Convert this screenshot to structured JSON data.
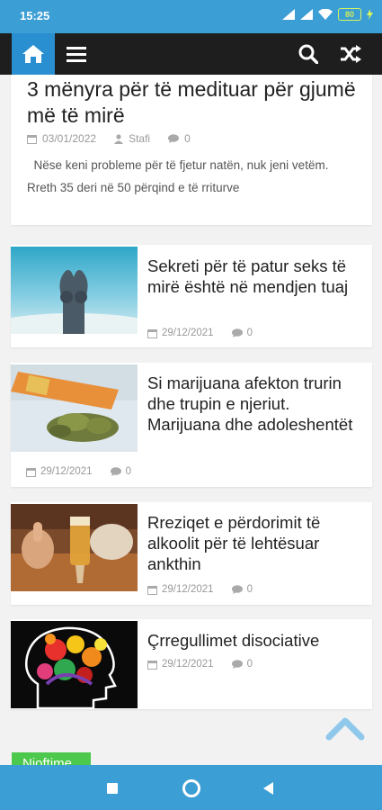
{
  "status_bar": {
    "time": "15:25",
    "battery": "80"
  },
  "header": {
    "icons": [
      "home-icon",
      "menu-icon",
      "search-icon",
      "shuffle-icon"
    ],
    "accent_color": "#2a8fd0",
    "background_color": "#1e1e1e"
  },
  "featured": {
    "title": "3 mënyra për të medituar për gjumë më të mirë",
    "date": "03/01/2022",
    "author": "Stafi",
    "comments": "0",
    "excerpt": "Nëse keni probleme për të fjetur natën, nuk jeni vetëm. Rreth 35 deri në 50 përqind e të rriturve"
  },
  "posts": [
    {
      "title": "Sekreti për të patur seks të mirë është në mendjen tuaj",
      "date": "29/12/2021",
      "comments": "0"
    },
    {
      "title": "Si marijuana afekton trurin dhe trupin e njeriut. Marijuana dhe adoleshentët",
      "date": "29/12/2021",
      "comments": "0"
    },
    {
      "title": "Rreziqet e përdorimit të alkoolit për të lehtësuar ankthin",
      "date": "29/12/2021",
      "comments": "0"
    },
    {
      "title": "Çrregullimet disociative",
      "date": "29/12/2021",
      "comments": "0"
    }
  ],
  "notice_button": {
    "label": "Njoftime"
  },
  "colors": {
    "status_bar": "#3b9ed4",
    "meta_text": "#999999",
    "notice": "#4cc84c",
    "scroll_top": "#8fc8ea"
  }
}
